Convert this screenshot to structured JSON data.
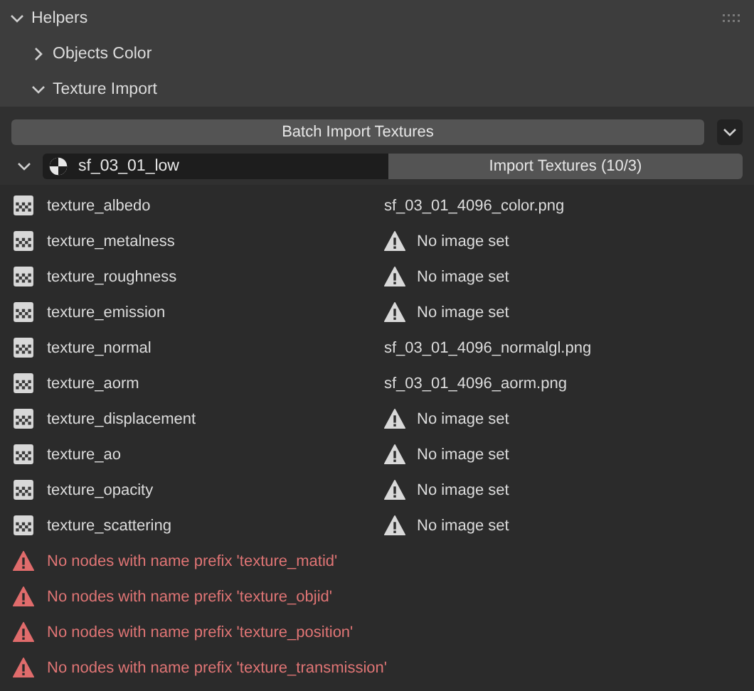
{
  "panel": {
    "title": "Helpers",
    "expanded": true
  },
  "subpanels": [
    {
      "title": "Objects Color",
      "expanded": false
    },
    {
      "title": "Texture Import",
      "expanded": true
    }
  ],
  "batch_button": "Batch Import Textures",
  "material": {
    "expanded": true,
    "name": "sf_03_01_low",
    "import_button": "Import Textures (10/3)"
  },
  "textures": [
    {
      "name": "texture_albedo",
      "kind": "image",
      "value": "sf_03_01_4096_color.png"
    },
    {
      "name": "texture_metalness",
      "kind": "missing",
      "value": "No image set"
    },
    {
      "name": "texture_roughness",
      "kind": "missing",
      "value": "No image set"
    },
    {
      "name": "texture_emission",
      "kind": "missing",
      "value": "No image set"
    },
    {
      "name": "texture_normal",
      "kind": "image",
      "value": "sf_03_01_4096_normalgl.png"
    },
    {
      "name": "texture_aorm",
      "kind": "image",
      "value": "sf_03_01_4096_aorm.png"
    },
    {
      "name": "texture_displacement",
      "kind": "missing",
      "value": "No image set"
    },
    {
      "name": "texture_ao",
      "kind": "missing",
      "value": "No image set"
    },
    {
      "name": "texture_opacity",
      "kind": "missing",
      "value": "No image set"
    },
    {
      "name": "texture_scattering",
      "kind": "missing",
      "value": "No image set"
    }
  ],
  "errors": [
    "No nodes with name prefix 'texture_matid'",
    "No nodes with name prefix 'texture_objid'",
    "No nodes with name prefix 'texture_position'",
    "No nodes with name prefix 'texture_transmission'"
  ]
}
